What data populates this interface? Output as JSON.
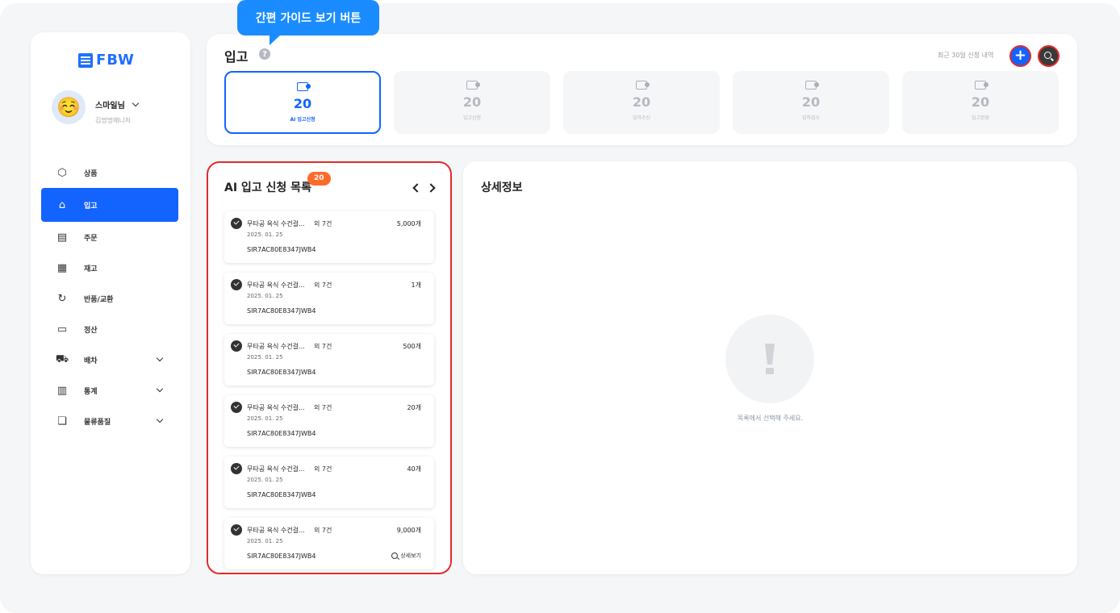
{
  "tooltip": {
    "text": "간편 가이드 보기 버튼"
  },
  "logo": {
    "text": "FBW"
  },
  "profile": {
    "avatar": "☺️",
    "name": "스마일님",
    "role": "김멍멍매니저"
  },
  "nav": {
    "items": [
      {
        "label": "상품",
        "icon": "box-icon",
        "glyph": "⬡",
        "active": false,
        "expandable": false
      },
      {
        "label": "입고",
        "icon": "warehouse-icon",
        "glyph": "⌂",
        "active": true,
        "expandable": false
      },
      {
        "label": "주문",
        "icon": "order-icon",
        "glyph": "▤",
        "active": false,
        "expandable": false
      },
      {
        "label": "재고",
        "icon": "inventory-icon",
        "glyph": "▦",
        "active": false,
        "expandable": false
      },
      {
        "label": "반품/교환",
        "icon": "return-icon",
        "glyph": "↻",
        "active": false,
        "expandable": false
      },
      {
        "label": "정산",
        "icon": "card-icon",
        "glyph": "▭",
        "active": false,
        "expandable": false
      },
      {
        "label": "배차",
        "icon": "car-icon",
        "glyph": "⛟",
        "active": false,
        "expandable": true
      },
      {
        "label": "통계",
        "icon": "chart-icon",
        "glyph": "▥",
        "active": false,
        "expandable": true
      },
      {
        "label": "물류품질",
        "icon": "chat-icon",
        "glyph": "❏",
        "active": false,
        "expandable": true
      }
    ]
  },
  "header": {
    "title": "입고",
    "help": "?",
    "recent_label": "최근 30일 신청 내역",
    "add_label": "+"
  },
  "stats": [
    {
      "value": "20",
      "label": "AI 입고신청",
      "active": true
    },
    {
      "value": "20",
      "label": "입고신청",
      "active": false
    },
    {
      "value": "20",
      "label": "입하수신",
      "active": false
    },
    {
      "value": "20",
      "label": "입하검수",
      "active": false
    },
    {
      "value": "20",
      "label": "입고완료",
      "active": false
    }
  ],
  "list": {
    "title": "AI 입고 신청 목록",
    "badge": "20",
    "items": [
      {
        "name": "무타공 욕식 수건걸...",
        "extra": "외 7건",
        "qty": "5,000개",
        "date": "2025. 01. 25",
        "code": "SIR7AC80E8347JWB4"
      },
      {
        "name": "무타공 욕식 수건걸...",
        "extra": "외 7건",
        "qty": "1개",
        "date": "2025. 01. 25",
        "code": "SIR7AC80E8347JWB4"
      },
      {
        "name": "무타공 욕식 수건걸...",
        "extra": "외 7건",
        "qty": "500개",
        "date": "2025. 01. 25",
        "code": "SIR7AC80E8347JWB4"
      },
      {
        "name": "무타공 욕식 수건걸...",
        "extra": "외 7건",
        "qty": "20개",
        "date": "2025. 01. 25",
        "code": "SIR7AC80E8347JWB4"
      },
      {
        "name": "무타공 욕식 수건걸...",
        "extra": "외 7건",
        "qty": "40개",
        "date": "2025. 01. 25",
        "code": "SIR7AC80E8347JWB4"
      },
      {
        "name": "무타공 욕식 수건걸...",
        "extra": "외 7건",
        "qty": "9,000개",
        "date": "2025. 01. 25",
        "code": "SIR7AC80E8347JWB4",
        "detail": "상세보기"
      }
    ]
  },
  "detail": {
    "title": "상세정보",
    "empty_text": "목록에서 선택해 주세요."
  }
}
